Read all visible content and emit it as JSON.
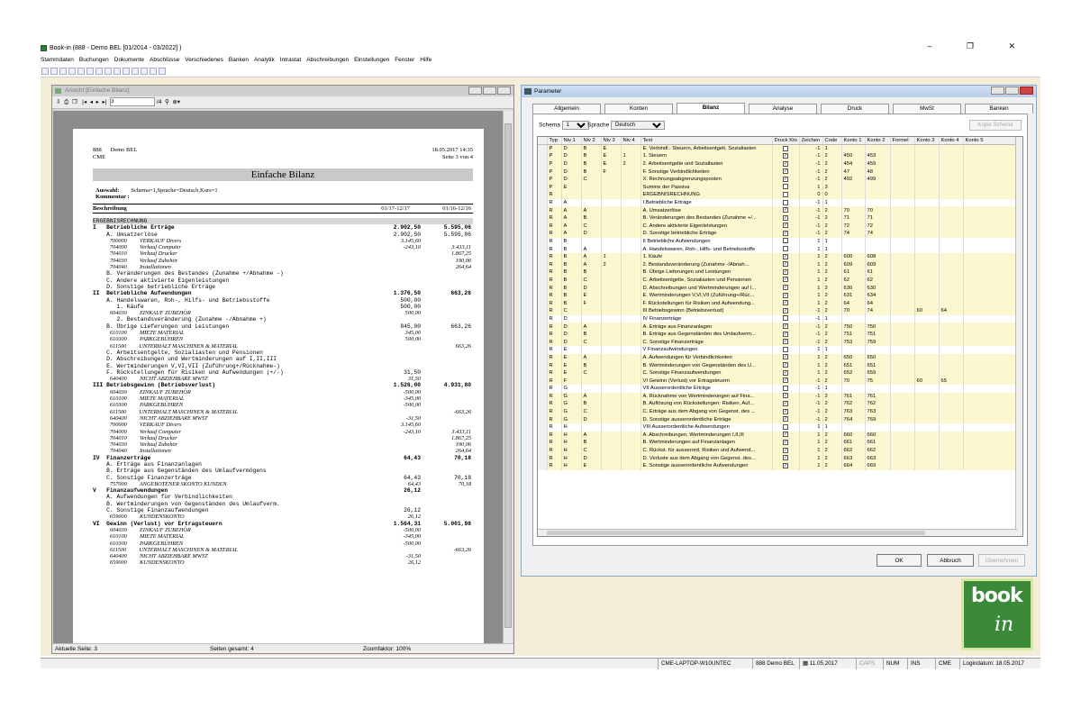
{
  "app": {
    "title": "Book-in (888 - Demo BEL [01/2014 - 03/2022] )",
    "window_controls": "–  ❐  ✕"
  },
  "menu": [
    "Stammdaten",
    "Buchungen",
    "Dokumente",
    "Abschlüsse",
    "Verschiedenes",
    "Banken",
    "Analytik",
    "Intrastat",
    "Abschreibungen",
    "Einstellungen",
    "Fenster",
    "Hilfe"
  ],
  "preview": {
    "window_title": "Ansicht [Einfache Bilanz]",
    "page_input": "3",
    "page_of": "/4",
    "status_page": "Aktuelle Seite: 3",
    "status_total": "Seiten gesamt: 4",
    "status_zoom": "Zoomfaktor: 100%",
    "report": {
      "company_code": "888",
      "company_name": "Demo BEL",
      "company_short": "CME",
      "datetime": "18.05.2017 14:35",
      "page": "Seite 3 von 4",
      "title": "Einfache Bilanz",
      "auswahl_label": "Auswahl:",
      "auswahl_value": "Schema=1,Sprache=Deutsch,Kurs=1",
      "kommentar_label": "Kommentar :",
      "col_desc": "Beschreibung",
      "col_p1": "01/17-12/17",
      "col_p2": "01/16-12/16",
      "rows": [
        {
          "t": "ERGEBNISRECHNUNG",
          "s": "sec"
        },
        {
          "t": "I   Betriebliche Erträge",
          "v1": "2.902,50",
          "v2": "5.595,06",
          "s": "b"
        },
        {
          "t": "    A. Umsatzerlöse",
          "v1": "2.902,50",
          "v2": "5.595,06"
        },
        {
          "t": "            700000         VERKAUF Divers",
          "v1": "3.145,60",
          "s": "it"
        },
        {
          "t": "            704000         Verkauf Computer",
          "v1": "-243,10",
          "v2": "3.433,11",
          "s": "it"
        },
        {
          "t": "            704010         Verkauf Drucker",
          "v2": "1.867,25",
          "s": "it"
        },
        {
          "t": "            704030         Verkauf Zubehör",
          "v2": "190,06",
          "s": "it"
        },
        {
          "t": "            704040         Installationen",
          "v2": "264,64",
          "s": "it"
        },
        {
          "t": "    B. Veränderungen des Bestandes (Zunahme +/Abnahme -)"
        },
        {
          "t": "    C. Andere aktivierte Eigenleistungen"
        },
        {
          "t": "    D. Sonstige betriebliche Erträge"
        },
        {
          "t": "II  Betriebliche Aufwendungen",
          "v1": "1.376,50",
          "v2": "663,26",
          "s": "b"
        },
        {
          "t": "    A. Handelswaren, Roh-, Hilfs- und Betriebsstoffe",
          "v1": "500,00"
        },
        {
          "t": "       1. Käufe",
          "v1": "500,00"
        },
        {
          "t": "            604030         EINKAUF ZUBEHÖR",
          "v1": "500,00",
          "s": "it"
        },
        {
          "t": "       2. Bestandsveränderung (Zunahme -/Abnahme +)"
        },
        {
          "t": "    B. Übrige Lieferungen und Leistungen",
          "v1": "845,00",
          "v2": "663,26"
        },
        {
          "t": "            610100         MIETE MATERIAL",
          "v1": "345,00",
          "s": "it"
        },
        {
          "t": "            610300         PARKGEBÜHREN",
          "v1": "500,00",
          "s": "it"
        },
        {
          "t": "            611500         UNTERHALT MASCHINEN & MATERIAL",
          "v2": "663,26",
          "s": "it"
        },
        {
          "t": "    C. Arbeitsentgelte, Sozialiasten und Pensionen"
        },
        {
          "t": "    D. Abschreibungen und Wertminderungen auf I,II,III"
        },
        {
          "t": "    E. Wertminderungen V,VI,VII (Zuführung+/Rücknahme-)"
        },
        {
          "t": "    F. Rückstellungen für Risiken und Aufwendungen (+/-)",
          "v1": "31,50"
        },
        {
          "t": "            640400         NICHT ABZIEHBARE MWST",
          "v1": "31,50",
          "s": "it"
        },
        {
          "t": "III Betriebsgewinn (Betriebsverlust)",
          "v1": "1.526,00",
          "v2": "4.931,80",
          "s": "b"
        },
        {
          "t": "            604030         EINKAUF ZUBEHÖR",
          "v1": "-500,00",
          "s": "it"
        },
        {
          "t": "            610100         MIETE MATERIAL",
          "v1": "-345,00",
          "s": "it"
        },
        {
          "t": "            610300         PARKGEBÜHREN",
          "v1": "-500,00",
          "s": "it"
        },
        {
          "t": "            611500         UNTERHALT MASCHINEN & MATERIAL",
          "v2": "-663,26",
          "s": "it"
        },
        {
          "t": "            640400         NICHT ABZIEHBARE MWST",
          "v1": "-31,50",
          "s": "it"
        },
        {
          "t": "            700000         VERKAUF Divers",
          "v1": "3.145,60",
          "s": "it"
        },
        {
          "t": "            704000         Verkauf Computer",
          "v1": "-243,10",
          "v2": "3.433,11",
          "s": "it"
        },
        {
          "t": "            704010         Verkauf Drucker",
          "v2": "1.867,25",
          "s": "it"
        },
        {
          "t": "            704030         Verkauf Zubehör",
          "v2": "190,06",
          "s": "it"
        },
        {
          "t": "            704040         Installationen",
          "v2": "264,64",
          "s": "it"
        },
        {
          "t": "IV  Finanzerträge",
          "v1": "64,43",
          "v2": "70,18",
          "s": "b"
        },
        {
          "t": "    A. Erträge aus Finanzanlagen"
        },
        {
          "t": "    B. Erträge aus Gegenständen des Umlaufvermögens"
        },
        {
          "t": "    C. Sonstige Finanzerträge",
          "v1": "64,43",
          "v2": "70,18"
        },
        {
          "t": "            757000         ANGEBOTENER SKONTO KUNDEN",
          "v1": "64,43",
          "v2": "70,18",
          "s": "it"
        },
        {
          "t": "V   Finanzaufwendungen",
          "v1": "26,12",
          "s": "b"
        },
        {
          "t": "    A. Aufwendungen für Verbindlichkeiten"
        },
        {
          "t": "    B. Wertminderungen von Gegenständen des Umlaufverm."
        },
        {
          "t": "    C. Sonstige Finanzaufwendungen",
          "v1": "26,12"
        },
        {
          "t": "            659000         KUNDENSKONTO",
          "v1": "26,12",
          "s": "it"
        },
        {
          "t": "VI  Gewinn (Verlust) vor Ertragsteuern",
          "v1": "1.564,31",
          "v2": "5.001,98",
          "s": "b"
        },
        {
          "t": "            604030         EINKAUF ZUBEHÖR",
          "v1": "-500,00",
          "s": "it"
        },
        {
          "t": "            610100         MIETE MATERIAL",
          "v1": "-345,00",
          "s": "it"
        },
        {
          "t": "            610300         PARKGEBÜHREN",
          "v1": "-500,00",
          "s": "it"
        },
        {
          "t": "            611500         UNTERHALT MASCHINEN & MATERIAL",
          "v2": "-663,26",
          "s": "it"
        },
        {
          "t": "            640400         NICHT ABZIEHBARE MWST",
          "v1": "-31,50",
          "s": "it"
        },
        {
          "t": "            659000         KUNDENSKONTO",
          "v1": "26,12",
          "s": "it"
        }
      ]
    }
  },
  "params": {
    "window_title": "Parameter",
    "tabs": [
      "Allgemein",
      "Konten",
      "Bilanz",
      "Analyse",
      "Druck",
      "MwSt",
      "Banken"
    ],
    "active_tab": "Bilanz",
    "schema_label": "Schema",
    "schema_value": "1",
    "sprache_label": "Sprache",
    "sprache_value": "Deutsch",
    "kopie_button": "Kopie Schema",
    "columns": [
      "Typ",
      "Niv 1",
      "Niv 2",
      "Niv 3",
      "Niv 4",
      "Text",
      "Druck Kto",
      "Zeichen",
      "Code",
      "Konto 1",
      "Konto 2",
      "Formel",
      "Konto 3",
      "Konto 4",
      "Konto 5"
    ],
    "rows": [
      [
        "P",
        "D",
        "B",
        "E",
        "",
        "E. Verbindl.: Steuern, Arbeitsentgelt, Sozialiasten",
        "0",
        "-1",
        "1",
        "",
        "",
        "",
        "",
        "",
        ""
      ],
      [
        "P",
        "D",
        "B",
        "E",
        "1",
        "1. Steuern",
        "1",
        "-1",
        "2",
        "450",
        "453",
        "",
        "",
        "",
        ""
      ],
      [
        "P",
        "D",
        "B",
        "E",
        "2",
        "2. Arbeitsentgelte und Soziallasten",
        "1",
        "-1",
        "2",
        "454",
        "459",
        "",
        "",
        "",
        ""
      ],
      [
        "P",
        "D",
        "B",
        "F",
        "",
        "F. Sonstige Verbindlichkeiten",
        "1",
        "-1",
        "2",
        "47",
        "48",
        "",
        "",
        "",
        ""
      ],
      [
        "P",
        "D",
        "C",
        "",
        "",
        "X. Rechnungsabgrenzungsposten",
        "1",
        "-1",
        "2",
        "492",
        "499",
        "",
        "",
        "",
        ""
      ],
      [
        "P",
        "E",
        "",
        "",
        "",
        "Summe der Passiva",
        "0",
        "1",
        "3",
        "",
        "",
        "",
        "",
        "",
        ""
      ],
      [
        "R",
        "",
        "",
        "",
        "",
        "ERGEBNISRECHNUNG",
        "0",
        "0",
        "0",
        "",
        "",
        "",
        "",
        "",
        ""
      ],
      [
        "R",
        "A",
        "",
        "",
        "",
        "I  Betriebliche Erträge",
        "0",
        "-1",
        "1",
        "",
        "",
        "",
        "",
        "",
        ""
      ],
      [
        "R",
        "A",
        "A",
        "",
        "",
        "A. Umsatzerlöse",
        "1",
        "-1",
        "2",
        "70",
        "70",
        "",
        "",
        "",
        ""
      ],
      [
        "R",
        "A",
        "B",
        "",
        "",
        "B. Veränderungen des Bestandes (Zunahme +/...",
        "1",
        "-1",
        "2",
        "71",
        "71",
        "",
        "",
        "",
        ""
      ],
      [
        "R",
        "A",
        "C",
        "",
        "",
        "C. Andere aktivierte Eigenleistungen",
        "1",
        "-1",
        "2",
        "72",
        "72",
        "",
        "",
        "",
        ""
      ],
      [
        "R",
        "A",
        "D",
        "",
        "",
        "D. Sonstige betriebliche Erträge",
        "1",
        "-1",
        "2",
        "74",
        "74",
        "",
        "",
        "",
        ""
      ],
      [
        "R",
        "B",
        "",
        "",
        "",
        "II  Betriebliche Aufwendungen",
        "0",
        "1",
        "1",
        "",
        "",
        "",
        "",
        "",
        ""
      ],
      [
        "R",
        "B",
        "A",
        "",
        "",
        "A. Handelswaren, Roh-, Hilfs- und Betriebsstoffe",
        "0",
        "1",
        "1",
        "",
        "",
        "",
        "",
        "",
        ""
      ],
      [
        "R",
        "B",
        "A",
        "1",
        "",
        "1. Käufe",
        "1",
        "1",
        "2",
        "600",
        "608",
        "",
        "",
        "",
        ""
      ],
      [
        "R",
        "B",
        "A",
        "2",
        "",
        "2. Bestandsveränderung (Zunahme -/Abnah...",
        "1",
        "1",
        "2",
        "609",
        "609",
        "",
        "",
        "",
        ""
      ],
      [
        "R",
        "B",
        "B",
        "",
        "",
        "B. Übrige Lieferungen und Leistungen",
        "1",
        "1",
        "2",
        "61",
        "61",
        "",
        "",
        "",
        ""
      ],
      [
        "R",
        "B",
        "C",
        "",
        "",
        "C. Arbeitsentgelte, Sozialiasten und Pensionen",
        "1",
        "1",
        "2",
        "62",
        "62",
        "",
        "",
        "",
        ""
      ],
      [
        "R",
        "B",
        "D",
        "",
        "",
        "D. Abschreibungen und Wertminderungen auf I...",
        "1",
        "1",
        "2",
        "630",
        "630",
        "",
        "",
        "",
        ""
      ],
      [
        "R",
        "B",
        "E",
        "",
        "",
        "E. Wertminderungen V,VI,VII (Zuführung+/Rüc...",
        "1",
        "1",
        "2",
        "631",
        "634",
        "",
        "",
        "",
        ""
      ],
      [
        "R",
        "B",
        "F",
        "",
        "",
        "F. Rückstellungen für Risiken und Aufwendung...",
        "1",
        "1",
        "2",
        "64",
        "64",
        "",
        "",
        "",
        ""
      ],
      [
        "R",
        "C",
        "",
        "",
        "",
        "III Betriebsgewinn (Betriebsverlust)",
        "1",
        "-1",
        "2",
        "70",
        "74",
        "",
        "60",
        "64",
        ""
      ],
      [
        "R",
        "D",
        "",
        "",
        "",
        "IV  Finanzerträge",
        "0",
        "-1",
        "1",
        "",
        "",
        "",
        "",
        "",
        ""
      ],
      [
        "R",
        "D",
        "A",
        "",
        "",
        "A. Erträge aus Finanzanlagen",
        "1",
        "-1",
        "2",
        "750",
        "750",
        "",
        "",
        "",
        ""
      ],
      [
        "R",
        "D",
        "B",
        "",
        "",
        "B. Erträge aus Gegenständen des Umlaufverm...",
        "1",
        "-1",
        "2",
        "751",
        "751",
        "",
        "",
        "",
        ""
      ],
      [
        "R",
        "D",
        "C",
        "",
        "",
        "C. Sonstige Finanzerträge",
        "1",
        "-1",
        "2",
        "753",
        "759",
        "",
        "",
        "",
        ""
      ],
      [
        "R",
        "E",
        "",
        "",
        "",
        "V  Finanzaufwendungen",
        "0",
        "1",
        "1",
        "",
        "",
        "",
        "",
        "",
        ""
      ],
      [
        "R",
        "E",
        "A",
        "",
        "",
        "A. Aufwendungen für Verbindlichkeiten",
        "1",
        "1",
        "2",
        "650",
        "650",
        "",
        "",
        "",
        ""
      ],
      [
        "R",
        "E",
        "B",
        "",
        "",
        "B. Wertminderungen von Gegenständen des U...",
        "1",
        "1",
        "2",
        "651",
        "651",
        "",
        "",
        "",
        ""
      ],
      [
        "R",
        "E",
        "C",
        "",
        "",
        "C. Sonstige Finanzaufwendungen",
        "1",
        "1",
        "2",
        "652",
        "659",
        "",
        "",
        "",
        ""
      ],
      [
        "R",
        "F",
        "",
        "",
        "",
        "VI  Gewinn (Verlust) vor Ertragsteuern",
        "1",
        "-1",
        "2",
        "70",
        "75",
        "",
        "60",
        "65",
        ""
      ],
      [
        "R",
        "G",
        "",
        "",
        "",
        "VII Ausserordentliche Erträge",
        "0",
        "-1",
        "1",
        "",
        "",
        "",
        "",
        "",
        ""
      ],
      [
        "R",
        "G",
        "A",
        "",
        "",
        "A. Rücknahme von Wertminderungen auf Fina...",
        "1",
        "-1",
        "2",
        "761",
        "761",
        "",
        "",
        "",
        ""
      ],
      [
        "R",
        "G",
        "B",
        "",
        "",
        "B. Auflösung von Rückstellungen: Risiken, Auf...",
        "1",
        "-1",
        "2",
        "762",
        "762",
        "",
        "",
        "",
        ""
      ],
      [
        "R",
        "G",
        "C",
        "",
        "",
        "C. Erträge aus dem Abgang von Gegenst. des ...",
        "1",
        "-1",
        "2",
        "763",
        "763",
        "",
        "",
        "",
        ""
      ],
      [
        "R",
        "G",
        "D",
        "",
        "",
        "D. Sonstige ausserordentliche Erträge",
        "1",
        "-1",
        "2",
        "764",
        "769",
        "",
        "",
        "",
        ""
      ],
      [
        "R",
        "H",
        "",
        "",
        "",
        "VIII Ausserordentliche Aufwendungen",
        "0",
        "1",
        "1",
        "",
        "",
        "",
        "",
        "",
        ""
      ],
      [
        "R",
        "H",
        "A",
        "",
        "",
        "A. Abschreibungen, Wertminderungen I,II,III",
        "1",
        "1",
        "2",
        "660",
        "660",
        "",
        "",
        "",
        ""
      ],
      [
        "R",
        "H",
        "B",
        "",
        "",
        "B. Wertminderungen auf Finanzanlagen",
        "1",
        "1",
        "2",
        "661",
        "661",
        "",
        "",
        "",
        ""
      ],
      [
        "R",
        "H",
        "C",
        "",
        "",
        "C. Rückst. für ausserord. Risiken und Aufwend...",
        "1",
        "1",
        "2",
        "662",
        "662",
        "",
        "",
        "",
        ""
      ],
      [
        "R",
        "H",
        "D",
        "",
        "",
        "D. Verluste aus dem Abgang von Gegenst. des...",
        "1",
        "1",
        "2",
        "663",
        "663",
        "",
        "",
        "",
        ""
      ],
      [
        "R",
        "H",
        "E",
        "",
        "",
        "E. Sonstige ausserordentliche Aufwendungen",
        "1",
        "1",
        "2",
        "664",
        "669",
        "",
        "",
        "",
        ""
      ]
    ],
    "ok_button": "OK",
    "cancel_button": "Abbruch",
    "apply_button": "Übernehmen"
  },
  "logo": {
    "text": "book",
    "sub": "in"
  },
  "status": {
    "computer": "CME-LAPTOP-W10UNTEC",
    "company": "888 Demo BEL",
    "date": "11.05.2017",
    "caps": "CAPS",
    "num": "NUM",
    "ins": "INS",
    "user": "CME",
    "login": "Logindatum: 18.05.2017"
  }
}
